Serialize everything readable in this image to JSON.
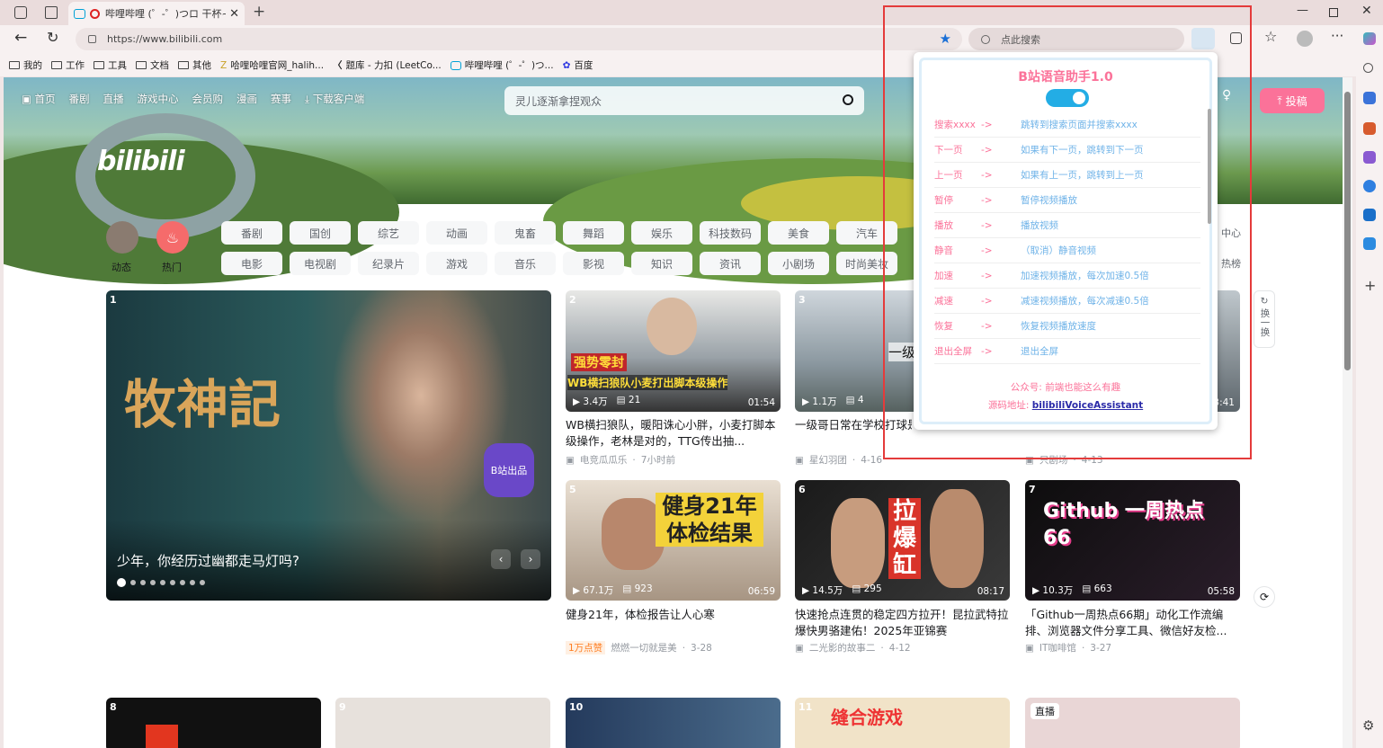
{
  "browser": {
    "tab_title": "哔哩哔哩 (゜-゜)つロ 干杯~",
    "url": "https://www.bilibili.com",
    "search_placeholder": "点此搜索",
    "bookmarks": [
      "我的",
      "工作",
      "工具",
      "文档",
      "其他",
      "哈哩哈哩官网_halih...",
      "题库 - 力扣 (LeetCo...",
      "哔哩哔哩 (゜-゜)つ...",
      "百度"
    ]
  },
  "nav": {
    "links": [
      "首页",
      "番剧",
      "直播",
      "游戏中心",
      "会员购",
      "漫画",
      "赛事",
      "下载客户端"
    ],
    "search_placeholder": "灵儿逐渐拿捏观众",
    "upload": "投稿",
    "creator_center": "创作中心"
  },
  "channels": {
    "dynamic": "动态",
    "hot": "热门",
    "row1": [
      "番剧",
      "国创",
      "综艺",
      "动画",
      "鬼畜",
      "舞蹈",
      "娱乐",
      "科技数码",
      "美食",
      "汽车"
    ],
    "row2": [
      "电影",
      "电视剧",
      "纪录片",
      "游戏",
      "音乐",
      "影视",
      "知识",
      "资讯",
      "小剧场",
      "时尚美妆"
    ],
    "right_top": "中心",
    "right_bottom": "热榜"
  },
  "carousel": {
    "number": "1",
    "caption": "少年，你经历过幽都走马灯吗?",
    "art_text": "牧神記",
    "badge": "B站出品"
  },
  "videos": [
    {
      "num": "2",
      "views": "3.4万",
      "danmaku": "21",
      "duration": "01:54",
      "title": "WB横扫狼队，暖阳诛心小胖，小麦打脚本级操作，老林是对的，TTG传出抽...",
      "author": "电竞瓜瓜乐",
      "date": "7小时前",
      "overlay": "强势零封",
      "overlay2": "WB横扫狼队小麦打出脚本级操作"
    },
    {
      "num": "3",
      "views": "1.1万",
      "danmaku": "4",
      "title": "一级哥日常在学校打球是怎样的",
      "author": "星幻羽团",
      "date": "4-16",
      "overlay": "一级日"
    },
    {
      "num": "4",
      "duration": "3:41",
      "author": "只剧场",
      "date": "4-13"
    },
    {
      "num": "5",
      "views": "67.1万",
      "danmaku": "923",
      "duration": "06:59",
      "title": "健身21年，体检报告让人心寒",
      "author": "燃燃一切就是美",
      "date": "3-28",
      "tag": "1万点赞",
      "overlay": "健身21年体检结果"
    },
    {
      "num": "6",
      "views": "14.5万",
      "danmaku": "295",
      "duration": "08:17",
      "title": "快速抢点连贯的稳定四方拉开！昆拉武特拉爆快男骆建佑！2025年亚锦赛",
      "author": "二光影的故事二",
      "date": "4-12",
      "overlay": "拉爆缸"
    },
    {
      "num": "7",
      "views": "10.3万",
      "danmaku": "663",
      "duration": "05:58",
      "title": "「Github一周热点66期」动化工作流编排、浏览器文件分享工具、微信好友检...",
      "author": "IT咖啡馆",
      "date": "3-27",
      "overlay": "Github 一周热点 66"
    },
    {
      "num": "8"
    },
    {
      "num": "9"
    },
    {
      "num": "10"
    },
    {
      "num": "11",
      "overlay": "缝合游戏"
    },
    {
      "live": "直播"
    }
  ],
  "refresh": "换一换",
  "assistant": {
    "title": "B站语音助手1.0",
    "commands": [
      {
        "cmd": "搜索xxxx",
        "arrow": "->",
        "desc": "跳转到搜索页面并搜索xxxx"
      },
      {
        "cmd": "下一页",
        "arrow": "->",
        "desc": "如果有下一页，跳转到下一页"
      },
      {
        "cmd": "上一页",
        "arrow": "->",
        "desc": "如果有上一页，跳转到上一页"
      },
      {
        "cmd": "暂停",
        "arrow": "->",
        "desc": "暂停视频播放"
      },
      {
        "cmd": "播放",
        "arrow": "->",
        "desc": "播放视频"
      },
      {
        "cmd": "静音",
        "arrow": "->",
        "desc": "（取消）静音视频"
      },
      {
        "cmd": "加速",
        "arrow": "->",
        "desc": "加速视频播放，每次加速0.5倍"
      },
      {
        "cmd": "减速",
        "arrow": "->",
        "desc": "减速视频播放，每次减速0.5倍"
      },
      {
        "cmd": "恢复",
        "arrow": "->",
        "desc": "恢复视频播放速度"
      },
      {
        "cmd": "退出全屏",
        "arrow": "->",
        "desc": "退出全屏"
      }
    ],
    "footer_label": "公众号:",
    "footer_value": "前端也能这么有趣",
    "source_label": "源码地址:",
    "source_link": "bilibiliVoiceAssistant"
  },
  "colors": {
    "pink": "#fb7299",
    "blue": "#6fb3e8",
    "toggle": "#23ade5",
    "highlight": "#e43b3b"
  }
}
